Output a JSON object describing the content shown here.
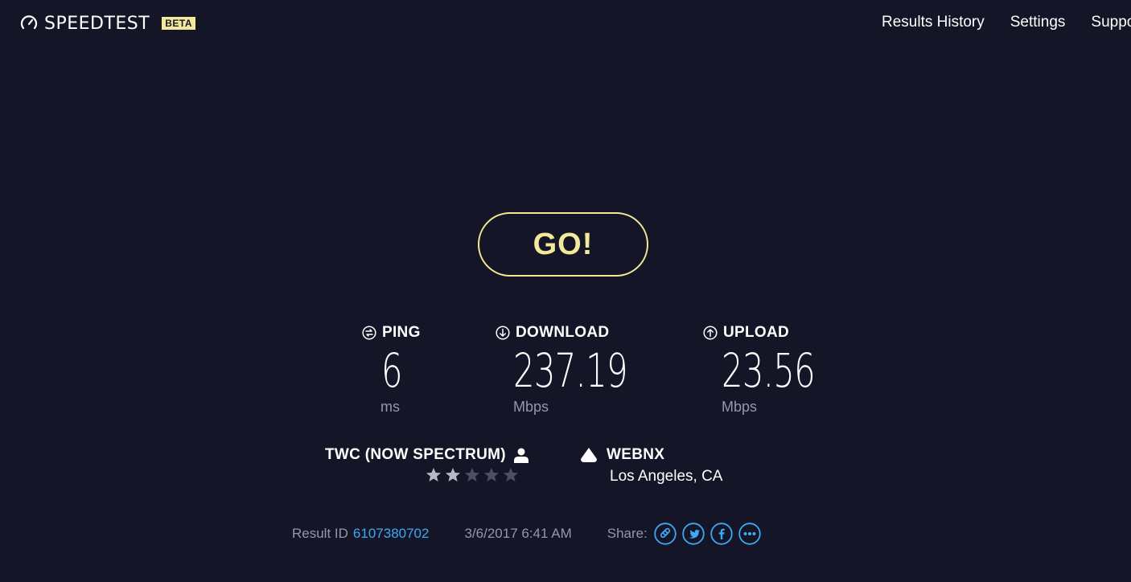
{
  "header": {
    "logo_text": "SPEEDTEST",
    "beta_badge": "BETA",
    "logo_icon": "gauge-icon",
    "nav": [
      "Results History",
      "Settings",
      "Support"
    ]
  },
  "go_button": {
    "label": "GO!"
  },
  "metrics": {
    "ping": {
      "label": "PING",
      "value": "6",
      "unit": "ms",
      "icon": "ping-icon"
    },
    "download": {
      "label": "DOWNLOAD",
      "value": "237.19",
      "unit": "Mbps",
      "icon": "download-arrow-icon"
    },
    "upload": {
      "label": "UPLOAD",
      "value": "23.56",
      "unit": "Mbps",
      "icon": "upload-arrow-icon"
    }
  },
  "isp": {
    "name": "TWC (NOW SPECTRUM)",
    "rating": 2,
    "max_rating": 5,
    "icon": "person-icon"
  },
  "server": {
    "name": "WEBNX",
    "location": "Los Angeles, CA",
    "icon": "server-icon"
  },
  "footer": {
    "result_id_label": "Result ID",
    "result_id": "6107380702",
    "timestamp": "3/6/2017 6:41 AM",
    "share_label": "Share:",
    "share_icons": [
      "link-icon",
      "twitter-icon",
      "facebook-icon",
      "more-icon"
    ]
  },
  "colors": {
    "background": "#141526",
    "accent": "#f4e99a",
    "link": "#3fa8f4",
    "muted": "#9496ad",
    "star_filled": "#b8b9c6",
    "star_empty": "#4d4f66"
  }
}
